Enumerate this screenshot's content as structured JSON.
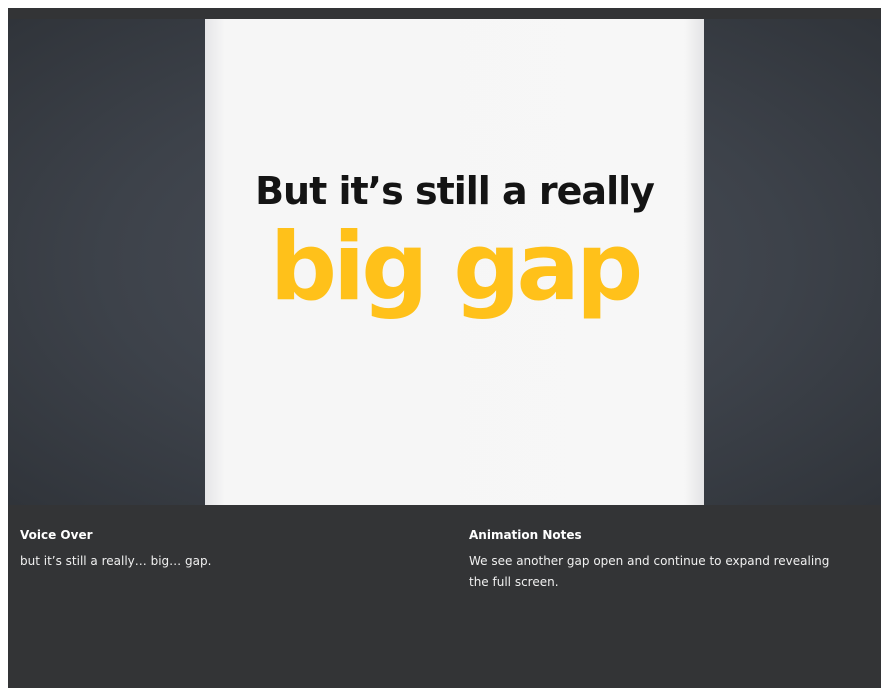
{
  "slide": {
    "headline": "But it’s still a really",
    "emphasis": "big gap",
    "emphasis_color": "#ffc11a",
    "headline_color": "#141414"
  },
  "notes": {
    "voice_over": {
      "title": "Voice Over",
      "body": "but it’s still a really… big… gap."
    },
    "animation_notes": {
      "title": "Animation Notes",
      "body": "We see another gap open and continue to expand revealing the full screen."
    }
  }
}
